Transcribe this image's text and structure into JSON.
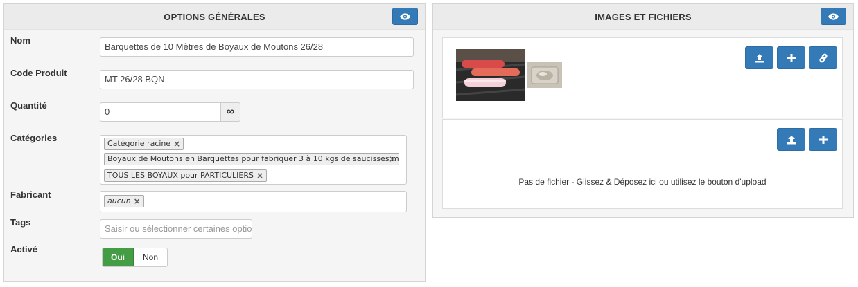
{
  "general": {
    "title": "OPTIONS GÉNÉRALES",
    "fields": {
      "name": {
        "label": "Nom",
        "value": "Barquettes de 10 Mètres de Boyaux de Moutons 26/28"
      },
      "code": {
        "label": "Code Produit",
        "value": "MT 26/28 BQN"
      },
      "quantity": {
        "label": "Quantité",
        "value": "0",
        "addon": "∞"
      },
      "categories": {
        "label": "Catégories",
        "tags": [
          "Catégorie racine",
          "Boyaux de Moutons en Barquettes pour fabriquer 3 à 10 kgs de saucisses maxi",
          "TOUS LES BOYAUX pour PARTICULIERS"
        ]
      },
      "manufacturer": {
        "label": "Fabricant",
        "tags": [
          "aucun"
        ]
      },
      "tags": {
        "label": "Tags",
        "placeholder": "Saisir ou sélectionner certaines options"
      },
      "active": {
        "label": "Activé",
        "on_label": "Oui",
        "off_label": "Non",
        "selected": "Oui"
      }
    }
  },
  "files": {
    "title": "IMAGES ET FICHIERS",
    "dropzone_text": "Pas de fichier - Glissez & Déposez ici ou utilisez le bouton d'upload"
  },
  "colors": {
    "primary": "#337ab7",
    "success": "#449d44",
    "panel_bg": "#f5f5f5",
    "panel_header_bg": "#ebebeb"
  },
  "icons": {
    "eye": "eye-icon",
    "upload": "upload-icon",
    "plus": "plus-icon",
    "link": "link-icon",
    "remove": "remove-icon",
    "infinity": "infinity-icon"
  }
}
